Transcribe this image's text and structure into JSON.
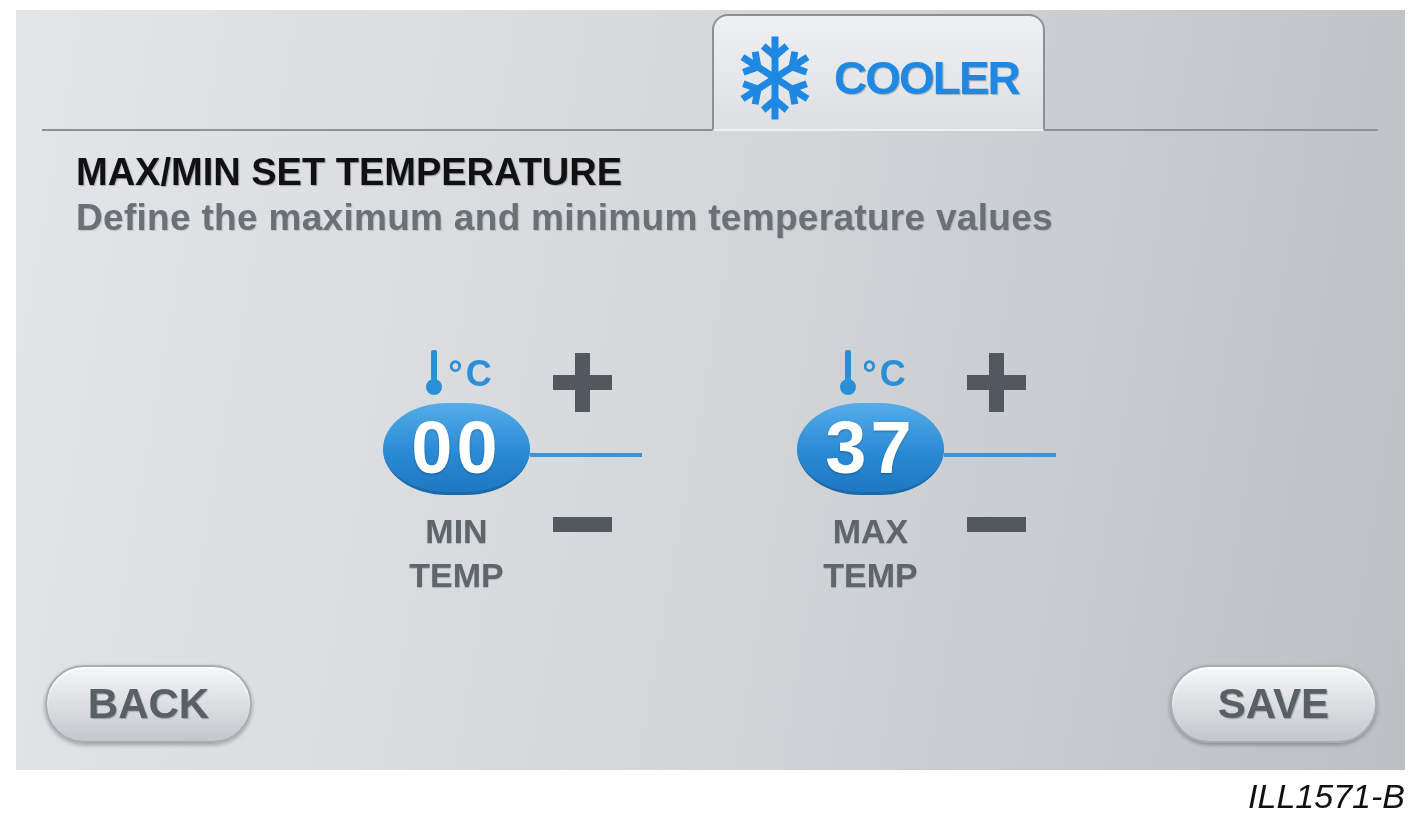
{
  "tab": {
    "label": "COOLER",
    "selected": true
  },
  "title": "MAX/MIN SET TEMPERATURE",
  "subtitle": "Define the maximum and minimum temperature values",
  "temperature_settings": [
    {
      "unit": "°C",
      "value": "00",
      "label": "MIN TEMP"
    },
    {
      "unit": "°C",
      "value": "37",
      "label": "MAX TEMP"
    }
  ],
  "back_button": {
    "label": "BACK"
  },
  "save_button": {
    "label": "SAVE"
  },
  "caption": "ILL1571-B"
}
